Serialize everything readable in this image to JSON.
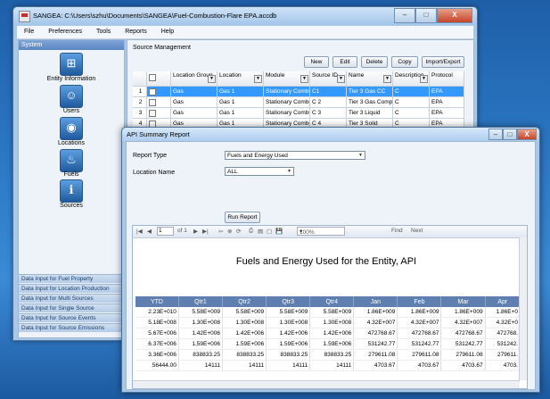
{
  "main_window": {
    "title": "SANGEA: C:\\Users\\szhu\\Documents\\SANGEA\\Fuel-Combustion-Flare EPA.accdb",
    "controls": {
      "minimize": "–",
      "maximize": "□",
      "close": "X"
    },
    "menu": [
      "File",
      "Preferences",
      "Tools",
      "Reports",
      "Help"
    ]
  },
  "sidebar": {
    "header": "System",
    "items": [
      {
        "label": "Entity Information",
        "icon": "entity-icon"
      },
      {
        "label": "Users",
        "icon": "users-icon"
      },
      {
        "label": "Locations",
        "icon": "locations-icon"
      },
      {
        "label": "Fuels",
        "icon": "fuels-icon"
      },
      {
        "label": "Sources",
        "icon": "sources-icon"
      }
    ],
    "bottom_items": [
      "Data Input for Fuel Property",
      "Data Input for Location Production",
      "Data Input for Multi Sources",
      "Data Input for Single Source",
      "Data Input for Source Events",
      "Data Input for Source Emissions"
    ]
  },
  "source_management": {
    "label": "Source Management",
    "buttons": [
      "New",
      "Edit",
      "Delete",
      "Copy",
      "Import/Export"
    ],
    "columns": [
      "",
      "",
      "Location Group",
      "Location",
      "Module",
      "Source ID",
      "Name",
      "Description",
      "Protocol"
    ],
    "rows": [
      {
        "num": "1",
        "group": "Gas",
        "location": "Gas 1",
        "module": "Stationary Combu...",
        "id": "C1",
        "name": "Tier 3 Gas CC",
        "desc": "C",
        "protocol": "EPA"
      },
      {
        "num": "2",
        "group": "Gas",
        "location": "Gas 1",
        "module": "Stationary Combu...",
        "id": "C 2",
        "name": "Tier 3 Gas Comp",
        "desc": "C",
        "protocol": "EPA"
      },
      {
        "num": "3",
        "group": "Gas",
        "location": "Gas 1",
        "module": "Stationary Combu...",
        "id": "C 3",
        "name": "Tier 3 Liquid",
        "desc": "C",
        "protocol": "EPA"
      },
      {
        "num": "4",
        "group": "Gas",
        "location": "Gas 1",
        "module": "Stationary Combu...",
        "id": "C 4",
        "name": "Tier 3 Solid",
        "desc": "C",
        "protocol": "EPA"
      }
    ]
  },
  "report_window": {
    "title": "API Summary Report",
    "report_type_label": "Report Type",
    "report_type_value": "Fuels and Energy Used",
    "location_name_label": "Location Name",
    "location_name_value": "ALL",
    "run_button": "Run Report",
    "toolbar": {
      "page": "1",
      "of": "of 1",
      "zoom": "100%",
      "find": "Find",
      "next": "Next"
    },
    "report_title": "Fuels and Energy Used for the Entity, API",
    "table": {
      "headers": [
        "YTD",
        "Qtr1",
        "Qtr2",
        "Qtr3",
        "Qtr4",
        "Jan",
        "Feb",
        "Mar",
        "Apr"
      ],
      "rows": [
        [
          "2.23E+010",
          "5.58E+009",
          "5.58E+009",
          "5.58E+009",
          "5.58E+009",
          "1.86E+009",
          "1.86E+009",
          "1.86E+009",
          "1.86E+0"
        ],
        [
          "5.18E+008",
          "1.30E+008",
          "1.30E+008",
          "1.30E+008",
          "1.30E+008",
          "4.32E+007",
          "4.32E+007",
          "4.32E+007",
          "4.32E+0"
        ],
        [
          "5.67E+006",
          "1.42E+006",
          "1.42E+006",
          "1.42E+006",
          "1.42E+006",
          "472768.67",
          "472768.67",
          "472768.67",
          "472768."
        ],
        [
          "6.37E+006",
          "1.59E+006",
          "1.59E+006",
          "1.59E+006",
          "1.59E+006",
          "531242.77",
          "531242.77",
          "531242.77",
          "531242."
        ],
        [
          "3.36E+006",
          "838833.25",
          "838833.25",
          "838833.25",
          "838833.25",
          "279611.08",
          "279611.08",
          "279611.08",
          "279611."
        ],
        [
          "56444.00",
          "14111",
          "14111",
          "14111",
          "14111",
          "4703.67",
          "4703.67",
          "4703.67",
          "4703."
        ]
      ]
    }
  }
}
